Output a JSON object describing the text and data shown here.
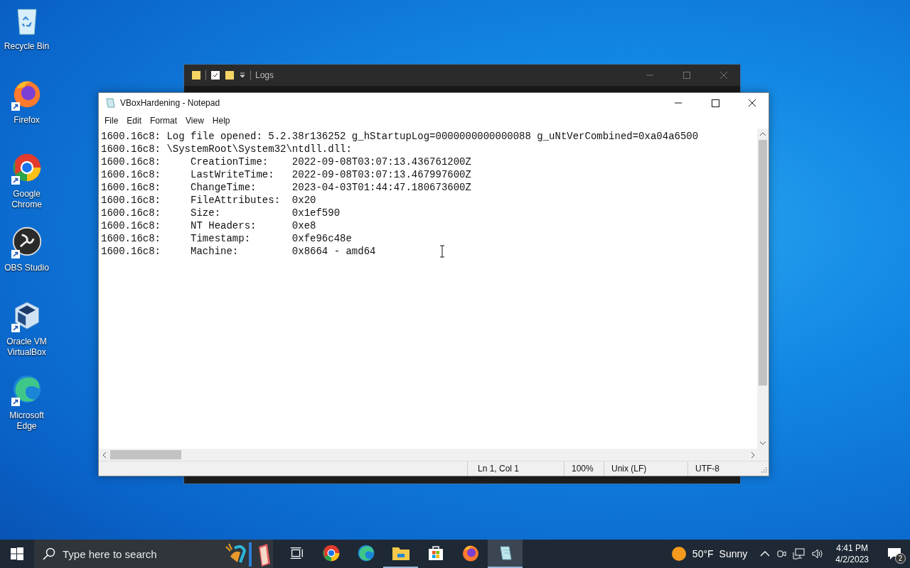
{
  "desktop_icons": [
    {
      "kind": "recycle",
      "label": "Recycle Bin",
      "shortcut": false
    },
    {
      "kind": "firefox",
      "label": "Firefox",
      "shortcut": true
    },
    {
      "kind": "chrome",
      "label": "Google Chrome",
      "shortcut": true
    },
    {
      "kind": "obs",
      "label": "OBS Studio",
      "shortcut": true
    },
    {
      "kind": "virtualbox",
      "label": "Oracle VM VirtualBox",
      "shortcut": true
    },
    {
      "kind": "edge",
      "label": "Microsoft Edge",
      "shortcut": true
    }
  ],
  "background_window": {
    "title": "Logs"
  },
  "notepad": {
    "title": "VBoxHardening - Notepad",
    "menu": [
      "File",
      "Edit",
      "Format",
      "View",
      "Help"
    ],
    "lines": [
      "1600.16c8: Log file opened: 5.2.38r136252 g_hStartupLog=0000000000000088 g_uNtVerCombined=0xa04a6500",
      "1600.16c8: \\SystemRoot\\System32\\ntdll.dll:",
      "1600.16c8:     CreationTime:    2022-09-08T03:07:13.436761200Z",
      "1600.16c8:     LastWriteTime:   2022-09-08T03:07:13.467997600Z",
      "1600.16c8:     ChangeTime:      2023-04-03T01:44:47.180673600Z",
      "1600.16c8:     FileAttributes:  0x20",
      "1600.16c8:     Size:            0x1ef590",
      "1600.16c8:     NT Headers:      0xe8",
      "1600.16c8:     Timestamp:       0xfe96c48e",
      "1600.16c8:     Machine:         0x8664 - amd64"
    ],
    "status_bar": [
      "Ln 1, Col 1",
      "100%",
      "Unix (LF)",
      "UTF-8"
    ]
  },
  "taskbar": {
    "search": {
      "placeholder": "Type here to search"
    },
    "apps": [
      {
        "kind": "taskview",
        "running": false,
        "selected": false
      },
      {
        "kind": "chrome",
        "running": false,
        "selected": false
      },
      {
        "kind": "edge",
        "running": false,
        "selected": false
      },
      {
        "kind": "explorer",
        "running": true,
        "selected": false
      },
      {
        "kind": "store",
        "running": false,
        "selected": false
      },
      {
        "kind": "firefox",
        "running": false,
        "selected": false
      },
      {
        "kind": "notepad",
        "running": true,
        "selected": true
      }
    ],
    "weather": {
      "temperature": "50°F",
      "condition": "Sunny"
    },
    "clock": {
      "time": "4:41 PM",
      "date": "4/2/2023"
    },
    "notifications": {
      "count": "2"
    }
  }
}
